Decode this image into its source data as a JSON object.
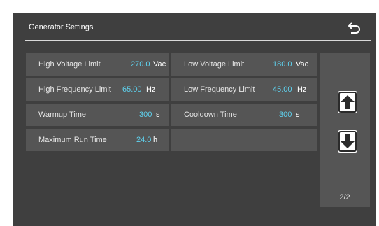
{
  "screen": {
    "title": "Generator Settings",
    "page_indicator": "2/2"
  },
  "icons": {
    "back": "back-arrow-icon",
    "up": "arrow-up-icon",
    "down": "arrow-down-icon"
  },
  "colors": {
    "background": "#3f3f3f",
    "cell": "#555555",
    "value": "#5fd3f0",
    "text": "#ffffff"
  },
  "settings": [
    {
      "label": "High Voltage Limit",
      "value": "270.0",
      "unit": "Vac"
    },
    {
      "label": "Low Voltage Limit",
      "value": "180.0",
      "unit": "Vac"
    },
    {
      "label": "High Frequency Limit",
      "value": "65.00",
      "unit": "Hz"
    },
    {
      "label": "Low Frequency Limit",
      "value": "45.00",
      "unit": "Hz"
    },
    {
      "label": "Warmup Time",
      "value": "300",
      "unit": "s"
    },
    {
      "label": "Cooldown Time",
      "value": "300",
      "unit": "s"
    },
    {
      "label": "Maximum Run Time",
      "value": "24.0",
      "unit": "h"
    }
  ]
}
